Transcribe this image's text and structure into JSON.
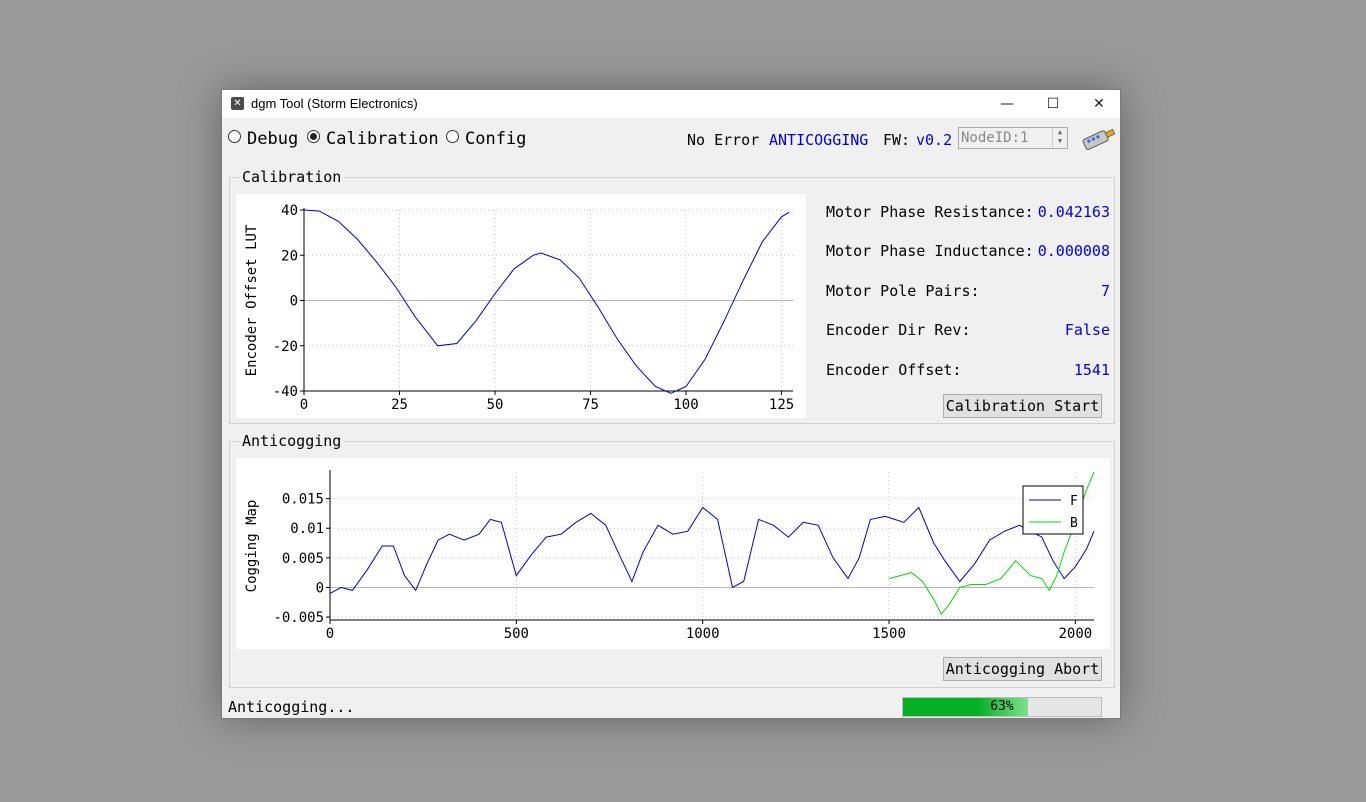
{
  "window": {
    "title": "dgm Tool (Storm Electronics)",
    "app_icon": "tool-icon",
    "minimize": "—",
    "maximize": "☐",
    "close": "✕"
  },
  "modes": [
    {
      "label": "Debug",
      "selected": false
    },
    {
      "label": "Calibration",
      "selected": true
    },
    {
      "label": "Config",
      "selected": false
    }
  ],
  "status": {
    "error": "No Error",
    "state": "ANTICOGGING",
    "fw_label": "FW:",
    "fw_version": "v0.2",
    "nodeid": "NodeID:1",
    "connect_icon": "usb-connector-icon"
  },
  "calibration": {
    "group_title": "Calibration",
    "params": [
      {
        "label": "Motor Phase Resistance:",
        "value": "0.042163"
      },
      {
        "label": "Motor Phase Inductance:",
        "value": "0.000008"
      },
      {
        "label": "Motor Pole Pairs:",
        "value": "7"
      },
      {
        "label": "Encoder Dir Rev:",
        "value": "False"
      },
      {
        "label": "Encoder Offset:",
        "value": "1541"
      }
    ],
    "start_button": "Calibration Start"
  },
  "anticogging": {
    "group_title": "Anticogging",
    "abort_button": "Anticogging Abort"
  },
  "footer": {
    "status_text": "Anticogging...",
    "progress": 63,
    "progress_text": "63%"
  },
  "colors": {
    "accent_text": "#0000dd",
    "series_F": "#0000cc",
    "series_B": "#00dd00",
    "progress_fill": "#06b025"
  },
  "chart_data": [
    {
      "type": "line",
      "ylabel": "Encoder Offset LUT",
      "xlim": [
        0,
        128
      ],
      "ylim": [
        -40,
        40
      ],
      "xticks": [
        0,
        25,
        50,
        75,
        100,
        125
      ],
      "yticks": [
        40,
        20,
        0,
        -20,
        -40
      ],
      "grid": true,
      "series": [
        {
          "x": [
            0,
            4,
            9,
            14,
            19,
            24,
            29,
            35,
            40,
            45,
            50,
            55,
            60,
            62,
            67,
            72,
            77,
            82,
            87,
            92,
            96,
            100,
            105,
            110,
            115,
            120,
            125,
            127
          ],
          "values": [
            40,
            39.5,
            35,
            27,
            17,
            6,
            -7,
            -20,
            -19,
            -9,
            3,
            14,
            20,
            21,
            18,
            10,
            -3,
            -17,
            -29,
            -38,
            -41,
            -38,
            -26,
            -9,
            9,
            26,
            37,
            39
          ]
        }
      ]
    },
    {
      "type": "line",
      "ylabel": "Cogging Map",
      "xlim": [
        0,
        2050
      ],
      "ylim": [
        -0.0055,
        0.0195
      ],
      "xticks": [
        0,
        500,
        1000,
        1500,
        2000
      ],
      "yticks": [
        0.015,
        0.01,
        0.005,
        0,
        -0.005
      ],
      "ytick_labels": [
        "0.015",
        "0.01",
        "0.005",
        "0",
        "-0.005"
      ],
      "grid": true,
      "legend": "top-right",
      "series": [
        {
          "name": "F",
          "x": [
            0,
            30,
            60,
            100,
            140,
            170,
            200,
            230,
            260,
            290,
            320,
            360,
            400,
            430,
            460,
            500,
            540,
            580,
            620,
            660,
            700,
            740,
            780,
            810,
            840,
            880,
            920,
            960,
            1000,
            1040,
            1080,
            1110,
            1150,
            1190,
            1230,
            1270,
            1310,
            1350,
            1390,
            1420,
            1450,
            1490,
            1540,
            1580,
            1620,
            1650,
            1690,
            1730,
            1770,
            1810,
            1850,
            1880,
            1910,
            1940,
            1970,
            2000,
            2030,
            2050
          ],
          "values": [
            -0.001,
            0.0,
            -0.0005,
            0.003,
            0.007,
            0.007,
            0.002,
            -0.0005,
            0.004,
            0.008,
            0.009,
            0.008,
            0.009,
            0.0115,
            0.011,
            0.002,
            0.0055,
            0.0085,
            0.009,
            0.011,
            0.0125,
            0.0105,
            0.005,
            0.001,
            0.006,
            0.0105,
            0.009,
            0.0095,
            0.0135,
            0.0115,
            0.0,
            0.001,
            0.0115,
            0.0105,
            0.0085,
            0.011,
            0.0105,
            0.005,
            0.0015,
            0.005,
            0.0115,
            0.012,
            0.011,
            0.0135,
            0.0075,
            0.0045,
            0.001,
            0.004,
            0.008,
            0.0095,
            0.0105,
            0.0095,
            0.0085,
            0.0045,
            0.0015,
            0.0035,
            0.0065,
            0.0095
          ]
        },
        {
          "name": "B",
          "x": [
            1500,
            1530,
            1560,
            1590,
            1620,
            1640,
            1660,
            1690,
            1720,
            1760,
            1800,
            1840,
            1880,
            1910,
            1930,
            1950,
            1970,
            2000,
            2030,
            2050
          ],
          "values": [
            0.0015,
            0.002,
            0.0025,
            0.001,
            -0.002,
            -0.0045,
            -0.003,
            0.0,
            0.0005,
            0.0005,
            0.0015,
            0.0045,
            0.002,
            0.0015,
            -0.0005,
            0.002,
            0.006,
            0.011,
            0.0165,
            0.0195
          ]
        }
      ]
    }
  ]
}
